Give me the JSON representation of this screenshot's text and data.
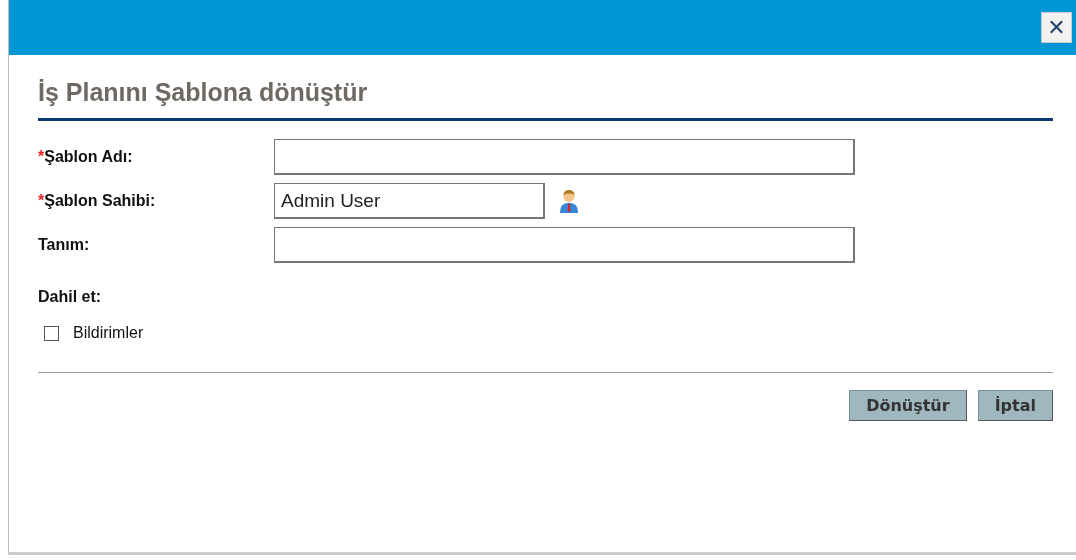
{
  "window": {
    "close": "✕"
  },
  "title": "İş Planını Şablona dönüştür",
  "fields": [
    {
      "kind": "text",
      "required_mark": "*",
      "label": "Şablon Adı:"
    },
    {
      "kind": "user",
      "required_mark": "*",
      "label": "Şablon Sahibi:",
      "value": "Admin User"
    },
    {
      "kind": "text",
      "label": "Tanım:"
    }
  ],
  "include": {
    "label": "Dahil et:",
    "options": [
      {
        "label": "Bildirimler",
        "checked": false
      }
    ]
  },
  "buttons": [
    "Dönüştür",
    "İptal"
  ]
}
